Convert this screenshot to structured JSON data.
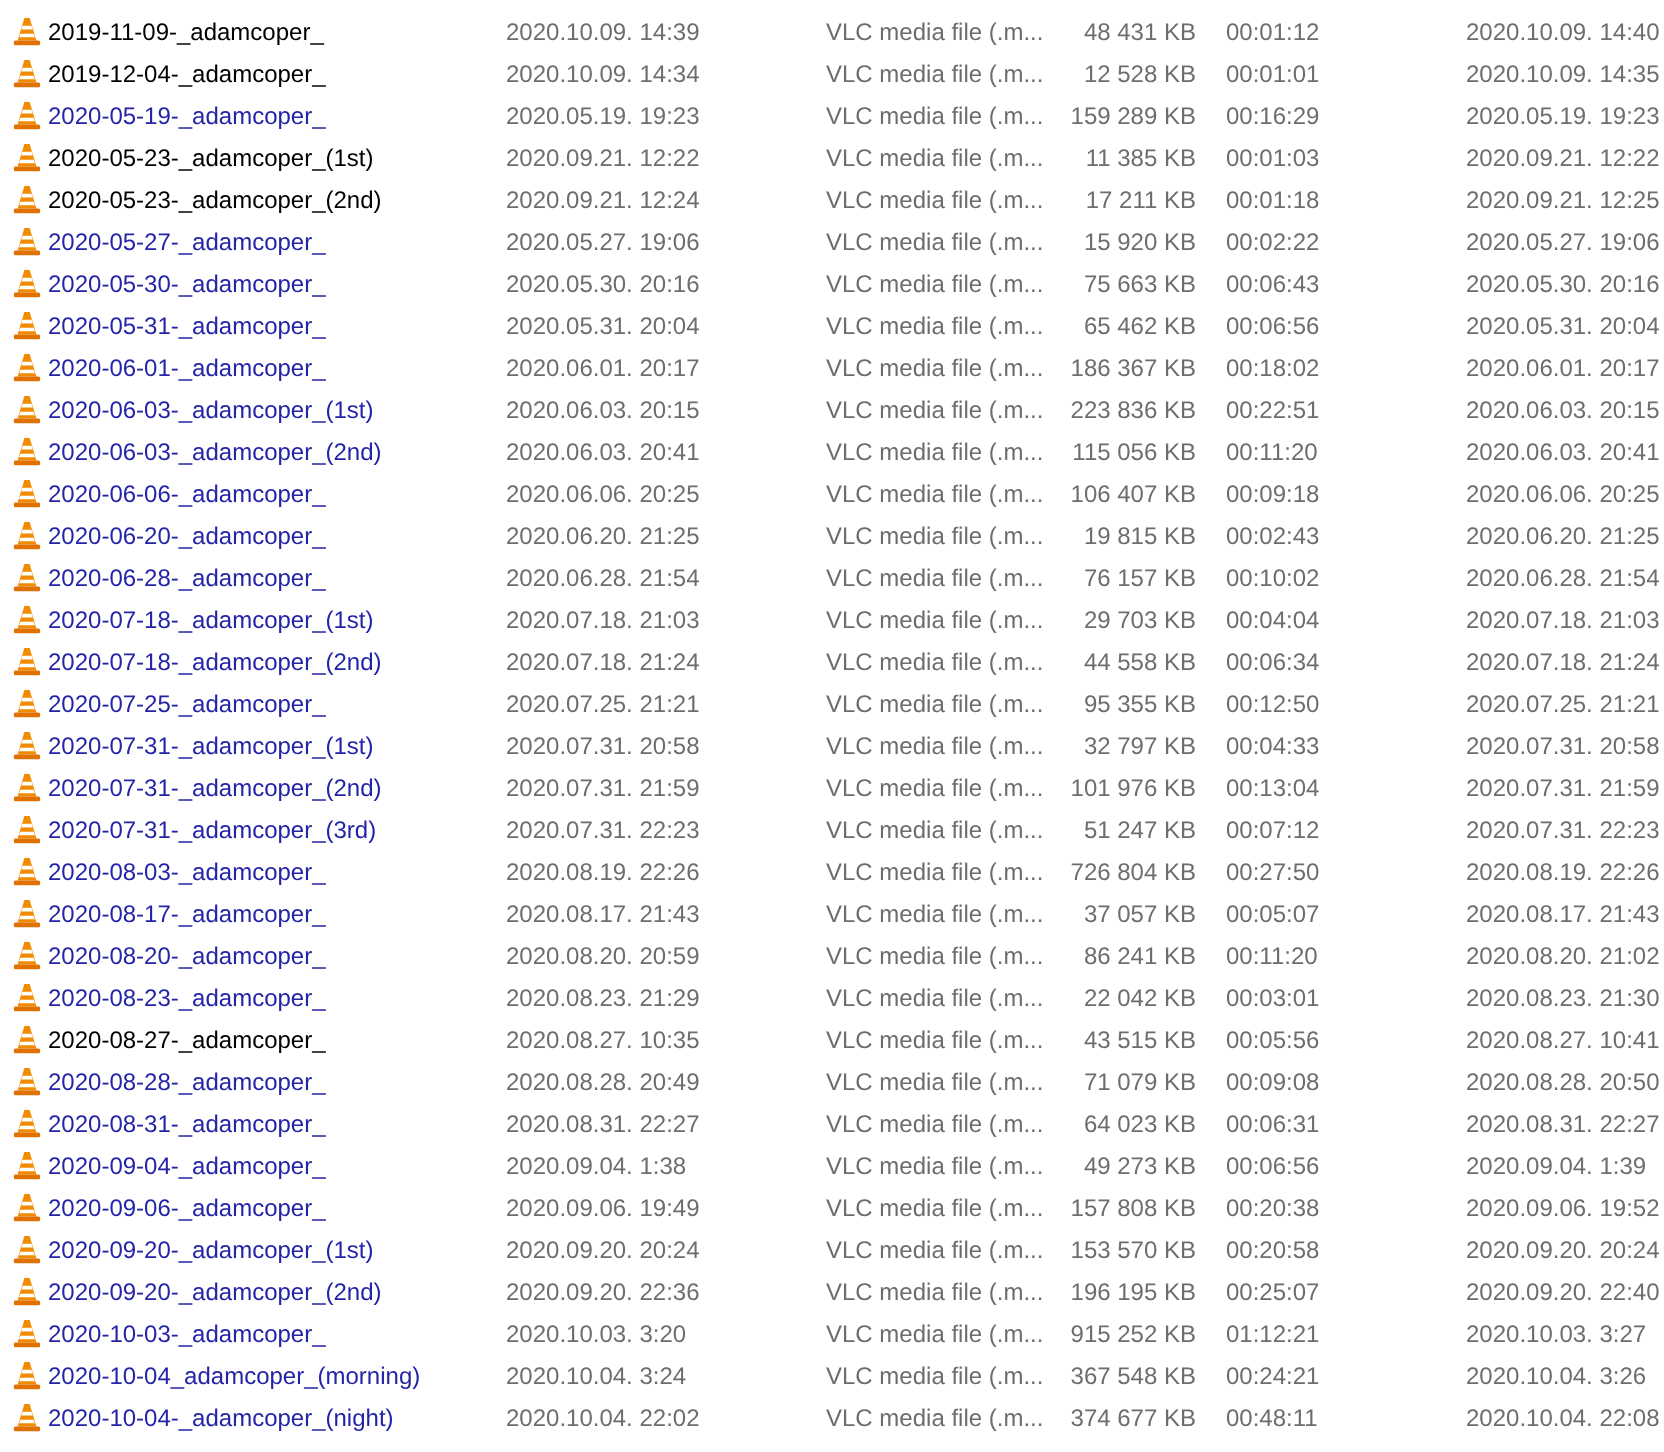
{
  "rows": [
    {
      "column_1": "2019-11-09-_adamcoper_",
      "color": "#000000",
      "column_2": "2020.10.09. 14:39",
      "column_3": "VLC media file (.m...",
      "column_4": "48 431 KB",
      "column_5": "00:01:12",
      "column_6": "2020.10.09. 14:40"
    },
    {
      "column_1": "2019-12-04-_adamcoper_",
      "color": "#000000",
      "column_2": "2020.10.09. 14:34",
      "column_3": "VLC media file (.m...",
      "column_4": "12 528 KB",
      "column_5": "00:01:01",
      "column_6": "2020.10.09. 14:35"
    },
    {
      "column_1": "2020-05-19-_adamcoper_",
      "color": "#2424a8",
      "column_2": "2020.05.19. 19:23",
      "column_3": "VLC media file (.m...",
      "column_4": "159 289 KB",
      "column_5": "00:16:29",
      "column_6": "2020.05.19. 19:23"
    },
    {
      "column_1": "2020-05-23-_adamcoper_(1st)",
      "color": "#000000",
      "column_2": "2020.09.21. 12:22",
      "column_3": "VLC media file (.m...",
      "column_4": "11 385 KB",
      "column_5": "00:01:03",
      "column_6": "2020.09.21. 12:22"
    },
    {
      "column_1": "2020-05-23-_adamcoper_(2nd)",
      "color": "#000000",
      "column_2": "2020.09.21. 12:24",
      "column_3": "VLC media file (.m...",
      "column_4": "17 211 KB",
      "column_5": "00:01:18",
      "column_6": "2020.09.21. 12:25"
    },
    {
      "column_1": "2020-05-27-_adamcoper_",
      "color": "#2424a8",
      "column_2": "2020.05.27. 19:06",
      "column_3": "VLC media file (.m...",
      "column_4": "15 920 KB",
      "column_5": "00:02:22",
      "column_6": "2020.05.27. 19:06"
    },
    {
      "column_1": "2020-05-30-_adamcoper_",
      "color": "#2424a8",
      "column_2": "2020.05.30. 20:16",
      "column_3": "VLC media file (.m...",
      "column_4": "75 663 KB",
      "column_5": "00:06:43",
      "column_6": "2020.05.30. 20:16"
    },
    {
      "column_1": "2020-05-31-_adamcoper_",
      "color": "#2424a8",
      "column_2": "2020.05.31. 20:04",
      "column_3": "VLC media file (.m...",
      "column_4": "65 462 KB",
      "column_5": "00:06:56",
      "column_6": "2020.05.31. 20:04"
    },
    {
      "column_1": "2020-06-01-_adamcoper_",
      "color": "#2424a8",
      "column_2": "2020.06.01. 20:17",
      "column_3": "VLC media file (.m...",
      "column_4": "186 367 KB",
      "column_5": "00:18:02",
      "column_6": "2020.06.01. 20:17"
    },
    {
      "column_1": "2020-06-03-_adamcoper_(1st)",
      "color": "#2424a8",
      "column_2": "2020.06.03. 20:15",
      "column_3": "VLC media file (.m...",
      "column_4": "223 836 KB",
      "column_5": "00:22:51",
      "column_6": "2020.06.03. 20:15"
    },
    {
      "column_1": "2020-06-03-_adamcoper_(2nd)",
      "color": "#2424a8",
      "column_2": "2020.06.03. 20:41",
      "column_3": "VLC media file (.m...",
      "column_4": "115 056 KB",
      "column_5": "00:11:20",
      "column_6": "2020.06.03. 20:41"
    },
    {
      "column_1": "2020-06-06-_adamcoper_",
      "color": "#2424a8",
      "column_2": "2020.06.06. 20:25",
      "column_3": "VLC media file (.m...",
      "column_4": "106 407 KB",
      "column_5": "00:09:18",
      "column_6": "2020.06.06. 20:25"
    },
    {
      "column_1": "2020-06-20-_adamcoper_",
      "color": "#2424a8",
      "column_2": "2020.06.20. 21:25",
      "column_3": "VLC media file (.m...",
      "column_4": "19 815 KB",
      "column_5": "00:02:43",
      "column_6": "2020.06.20. 21:25"
    },
    {
      "column_1": "2020-06-28-_adamcoper_",
      "color": "#2424a8",
      "column_2": "2020.06.28. 21:54",
      "column_3": "VLC media file (.m...",
      "column_4": "76 157 KB",
      "column_5": "00:10:02",
      "column_6": "2020.06.28. 21:54"
    },
    {
      "column_1": "2020-07-18-_adamcoper_(1st)",
      "color": "#2424a8",
      "column_2": "2020.07.18. 21:03",
      "column_3": "VLC media file (.m...",
      "column_4": "29 703 KB",
      "column_5": "00:04:04",
      "column_6": "2020.07.18. 21:03"
    },
    {
      "column_1": "2020-07-18-_adamcoper_(2nd)",
      "color": "#2424a8",
      "column_2": "2020.07.18. 21:24",
      "column_3": "VLC media file (.m...",
      "column_4": "44 558 KB",
      "column_5": "00:06:34",
      "column_6": "2020.07.18. 21:24"
    },
    {
      "column_1": "2020-07-25-_adamcoper_",
      "color": "#2424a8",
      "column_2": "2020.07.25. 21:21",
      "column_3": "VLC media file (.m...",
      "column_4": "95 355 KB",
      "column_5": "00:12:50",
      "column_6": "2020.07.25. 21:21"
    },
    {
      "column_1": "2020-07-31-_adamcoper_(1st)",
      "color": "#2424a8",
      "column_2": "2020.07.31. 20:58",
      "column_3": "VLC media file (.m...",
      "column_4": "32 797 KB",
      "column_5": "00:04:33",
      "column_6": "2020.07.31. 20:58"
    },
    {
      "column_1": "2020-07-31-_adamcoper_(2nd)",
      "color": "#2424a8",
      "column_2": "2020.07.31. 21:59",
      "column_3": "VLC media file (.m...",
      "column_4": "101 976 KB",
      "column_5": "00:13:04",
      "column_6": "2020.07.31. 21:59"
    },
    {
      "column_1": "2020-07-31-_adamcoper_(3rd)",
      "color": "#2424a8",
      "column_2": "2020.07.31. 22:23",
      "column_3": "VLC media file (.m...",
      "column_4": "51 247 KB",
      "column_5": "00:07:12",
      "column_6": "2020.07.31. 22:23"
    },
    {
      "column_1": "2020-08-03-_adamcoper_",
      "color": "#2424a8",
      "column_2": "2020.08.19. 22:26",
      "column_3": "VLC media file (.m...",
      "column_4": "726 804 KB",
      "column_5": "00:27:50",
      "column_6": "2020.08.19. 22:26"
    },
    {
      "column_1": "2020-08-17-_adamcoper_",
      "color": "#2424a8",
      "column_2": "2020.08.17. 21:43",
      "column_3": "VLC media file (.m...",
      "column_4": "37 057 KB",
      "column_5": "00:05:07",
      "column_6": "2020.08.17. 21:43"
    },
    {
      "column_1": "2020-08-20-_adamcoper_",
      "color": "#2424a8",
      "column_2": "2020.08.20. 20:59",
      "column_3": "VLC media file (.m...",
      "column_4": "86 241 KB",
      "column_5": "00:11:20",
      "column_6": "2020.08.20. 21:02"
    },
    {
      "column_1": "2020-08-23-_adamcoper_",
      "color": "#2424a8",
      "column_2": "2020.08.23. 21:29",
      "column_3": "VLC media file (.m...",
      "column_4": "22 042 KB",
      "column_5": "00:03:01",
      "column_6": "2020.08.23. 21:30"
    },
    {
      "column_1": "2020-08-27-_adamcoper_",
      "color": "#000000",
      "column_2": "2020.08.27. 10:35",
      "column_3": "VLC media file (.m...",
      "column_4": "43 515 KB",
      "column_5": "00:05:56",
      "column_6": "2020.08.27. 10:41"
    },
    {
      "column_1": "2020-08-28-_adamcoper_",
      "color": "#2424a8",
      "column_2": "2020.08.28. 20:49",
      "column_3": "VLC media file (.m...",
      "column_4": "71 079 KB",
      "column_5": "00:09:08",
      "column_6": "2020.08.28. 20:50"
    },
    {
      "column_1": "2020-08-31-_adamcoper_",
      "color": "#2424a8",
      "column_2": "2020.08.31. 22:27",
      "column_3": "VLC media file (.m...",
      "column_4": "64 023 KB",
      "column_5": "00:06:31",
      "column_6": "2020.08.31. 22:27"
    },
    {
      "column_1": "2020-09-04-_adamcoper_",
      "color": "#2424a8",
      "column_2": "2020.09.04. 1:38",
      "column_3": "VLC media file (.m...",
      "column_4": "49 273 KB",
      "column_5": "00:06:56",
      "column_6": "2020.09.04. 1:39"
    },
    {
      "column_1": "2020-09-06-_adamcoper_",
      "color": "#2424a8",
      "column_2": "2020.09.06. 19:49",
      "column_3": "VLC media file (.m...",
      "column_4": "157 808 KB",
      "column_5": "00:20:38",
      "column_6": "2020.09.06. 19:52"
    },
    {
      "column_1": "2020-09-20-_adamcoper_(1st)",
      "color": "#2424a8",
      "column_2": "2020.09.20. 20:24",
      "column_3": "VLC media file (.m...",
      "column_4": "153 570 KB",
      "column_5": "00:20:58",
      "column_6": "2020.09.20. 20:24"
    },
    {
      "column_1": "2020-09-20-_adamcoper_(2nd)",
      "color": "#2424a8",
      "column_2": "2020.09.20. 22:36",
      "column_3": "VLC media file (.m...",
      "column_4": "196 195 KB",
      "column_5": "00:25:07",
      "column_6": "2020.09.20. 22:40"
    },
    {
      "column_1": "2020-10-03-_adamcoper_",
      "color": "#2424a8",
      "column_2": "2020.10.03. 3:20",
      "column_3": "VLC media file (.m...",
      "column_4": "915 252 KB",
      "column_5": "01:12:21",
      "column_6": "2020.10.03. 3:27"
    },
    {
      "column_1": "2020-10-04_adamcoper_(morning)",
      "color": "#2424a8",
      "column_2": "2020.10.04. 3:24",
      "column_3": "VLC media file (.m...",
      "column_4": "367 548 KB",
      "column_5": "00:24:21",
      "column_6": "2020.10.04. 3:26"
    },
    {
      "column_1": "2020-10-04-_adamcoper_(night)",
      "color": "#2424a8",
      "column_2": "2020.10.04. 22:02",
      "column_3": "VLC media file (.m...",
      "column_4": "374 677 KB",
      "column_5": "00:48:11",
      "column_6": "2020.10.04. 22:08"
    }
  ]
}
